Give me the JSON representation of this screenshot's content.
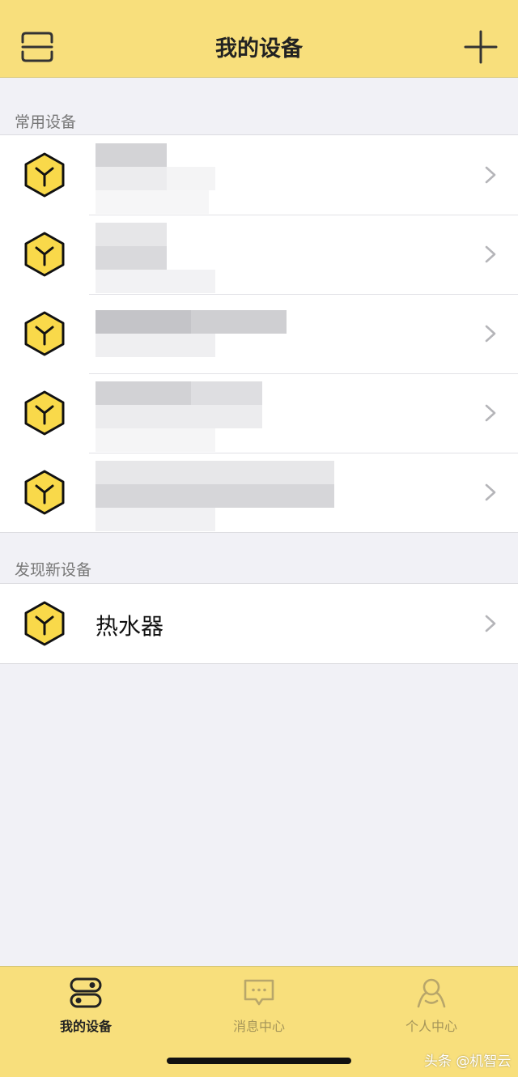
{
  "header": {
    "title": "我的设备",
    "scan_icon": "scan-icon",
    "add_icon": "plus-icon"
  },
  "common_devices": {
    "title": "常用设备",
    "items": [
      {
        "label": "",
        "icon": "device-cube-icon"
      },
      {
        "label": "",
        "icon": "device-cube-icon"
      },
      {
        "label": "",
        "icon": "device-cube-icon"
      },
      {
        "label": "",
        "icon": "device-cube-icon"
      },
      {
        "label": "",
        "icon": "device-cube-icon"
      }
    ]
  },
  "new_devices": {
    "title": "发现新设备",
    "items": [
      {
        "label": "热水器",
        "icon": "device-cube-icon"
      }
    ]
  },
  "tabbar": {
    "tabs": [
      {
        "label": "我的设备",
        "icon": "toggle-switch-icon",
        "active": true
      },
      {
        "label": "消息中心",
        "icon": "chat-bubble-icon",
        "active": false
      },
      {
        "label": "个人中心",
        "icon": "person-icon",
        "active": false
      }
    ]
  },
  "watermark": "头条 @机智云",
  "colors": {
    "header_bg": "#f8df7c",
    "accent": "#f8df7c",
    "icon_fill": "#f9d94a",
    "background": "#f1f1f6"
  }
}
